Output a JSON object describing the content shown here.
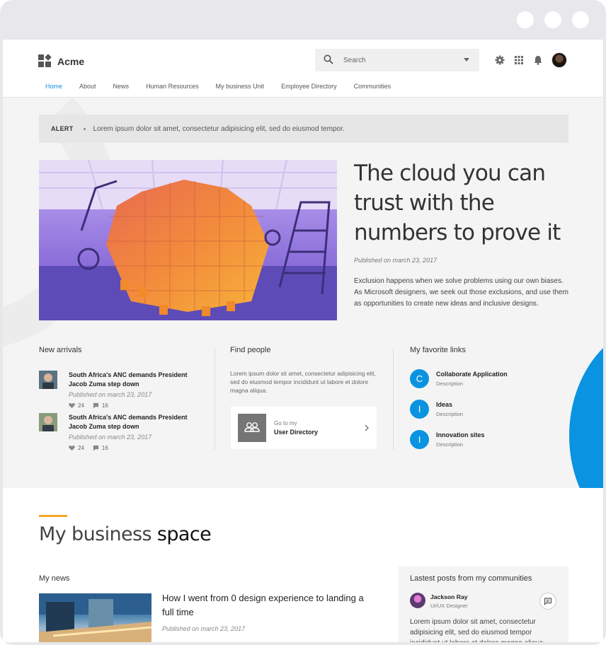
{
  "app": {
    "title": "Acme"
  },
  "search": {
    "placeholder": "Search"
  },
  "nav": {
    "items": [
      "Home",
      "About",
      "News",
      "Human Resources",
      "My business Unit",
      "Employee Directory",
      "Communities"
    ],
    "active": "Home"
  },
  "alert": {
    "label": "ALERT",
    "text": "Lorem ipsum dolor sit amet, consectetur adipisicing elit, sed do eiusmod tempor."
  },
  "hero": {
    "title_lines": [
      "The cloud you can",
      "trust with the",
      "numbers to prove it"
    ],
    "date": "Published on march 23, 2017",
    "body": "Exclusion happens when we solve problems using our own biases. As Microsoft designers, we seek out those exclusions, and use them as opportunities to create new ideas and inclusive designs."
  },
  "new_arrivals": {
    "title": "New arrivals",
    "items": [
      {
        "title": "South Africa's ANC demands President Jacob Zuma step down",
        "date": "Published on march 23, 2017",
        "likes": "24",
        "comments": "16"
      },
      {
        "title": "South Africa's ANC demands President Jacob Zuma step down",
        "date": "Published on march 23, 2017",
        "likes": "24",
        "comments": "16"
      }
    ]
  },
  "find_people": {
    "title": "Find people",
    "text": "Lorem ipsum dolor sit amet, consectetur adipisicing elit, sed do eiusmod tempor incididunt ut labore et dolore magna aliqua.",
    "card_small": "Go to my",
    "card_big": "User Directory"
  },
  "favorites": {
    "title": "My favorite links",
    "items": [
      {
        "letter": "C",
        "name": "Collaborate Application",
        "desc": "Description"
      },
      {
        "letter": "I",
        "name": "Ideas",
        "desc": "Description"
      },
      {
        "letter": "I",
        "name": "Innovation sites",
        "desc": "Description"
      }
    ]
  },
  "business_space": {
    "title_light": "My business",
    "title_bold": "space",
    "my_news_title": "My news",
    "news_headline": "How I went from 0 design experience to landing a full time",
    "news_date": "Published on march 23, 2017",
    "posts_title": "Lastest posts from my communities",
    "post_name": "Jackson Ray",
    "post_role": "UI/UX Designer",
    "post_text": "Lorem ipsum dolor sit amet, consectetur adipisicing elit, sed do eiusmod tempor incididunt ut labore et dolore magna aliqua."
  },
  "colors": {
    "accent": "#1e8ee0",
    "fav_circle": "#0a93e0",
    "underline": "#f5a623"
  },
  "icons": [
    "logo-icon",
    "search-icon",
    "gear-icon",
    "grid-icon",
    "bell-icon",
    "heart-icon",
    "comment-icon",
    "people-icon",
    "chevron-right-icon",
    "message-icon"
  ]
}
